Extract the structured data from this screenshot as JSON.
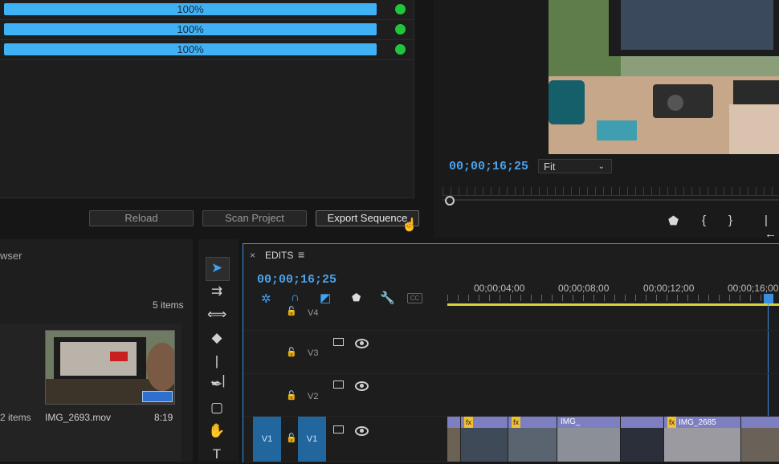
{
  "progress": {
    "rows": [
      {
        "label": "100%",
        "value": 100,
        "status_color": "#21c53b"
      },
      {
        "label": "100%",
        "value": 100,
        "status_color": "#21c53b"
      },
      {
        "label": "100%",
        "value": 100,
        "status_color": "#21c53b"
      }
    ],
    "bar_color": "#3fb1f5"
  },
  "actions": {
    "reload": "Reload",
    "scan": "Scan Project",
    "export": "Export Sequence"
  },
  "program_monitor": {
    "timecode": "00;00;16;25",
    "fit": "Fit",
    "controls": [
      "marker-icon",
      "in-point-icon",
      "out-point-icon",
      "go-to-in-icon"
    ]
  },
  "project": {
    "title": "wser",
    "count": "5 items",
    "left_caption": "2 items",
    "clip_name": "IMG_2693.mov",
    "clip_duration": "8:19"
  },
  "timeline": {
    "tab": "EDITS",
    "timecode": "00;00;16;25",
    "ruler": [
      "00;00;04;00",
      "00;00;08;00",
      "00;00;12;00",
      "00;00;16;00"
    ],
    "tracks": [
      {
        "name": "V4"
      },
      {
        "name": "V3"
      },
      {
        "name": "V2"
      },
      {
        "name": "V1",
        "source": "V1"
      }
    ],
    "clips": [
      {
        "label": ""
      },
      {
        "label": ""
      },
      {
        "label": ""
      },
      {
        "label": "IMG_"
      },
      {
        "label": ""
      },
      {
        "label": "IMG_2685"
      },
      {
        "label": ""
      }
    ],
    "accent": "#3a8fe0",
    "work_area_color": "#d8d23a"
  }
}
